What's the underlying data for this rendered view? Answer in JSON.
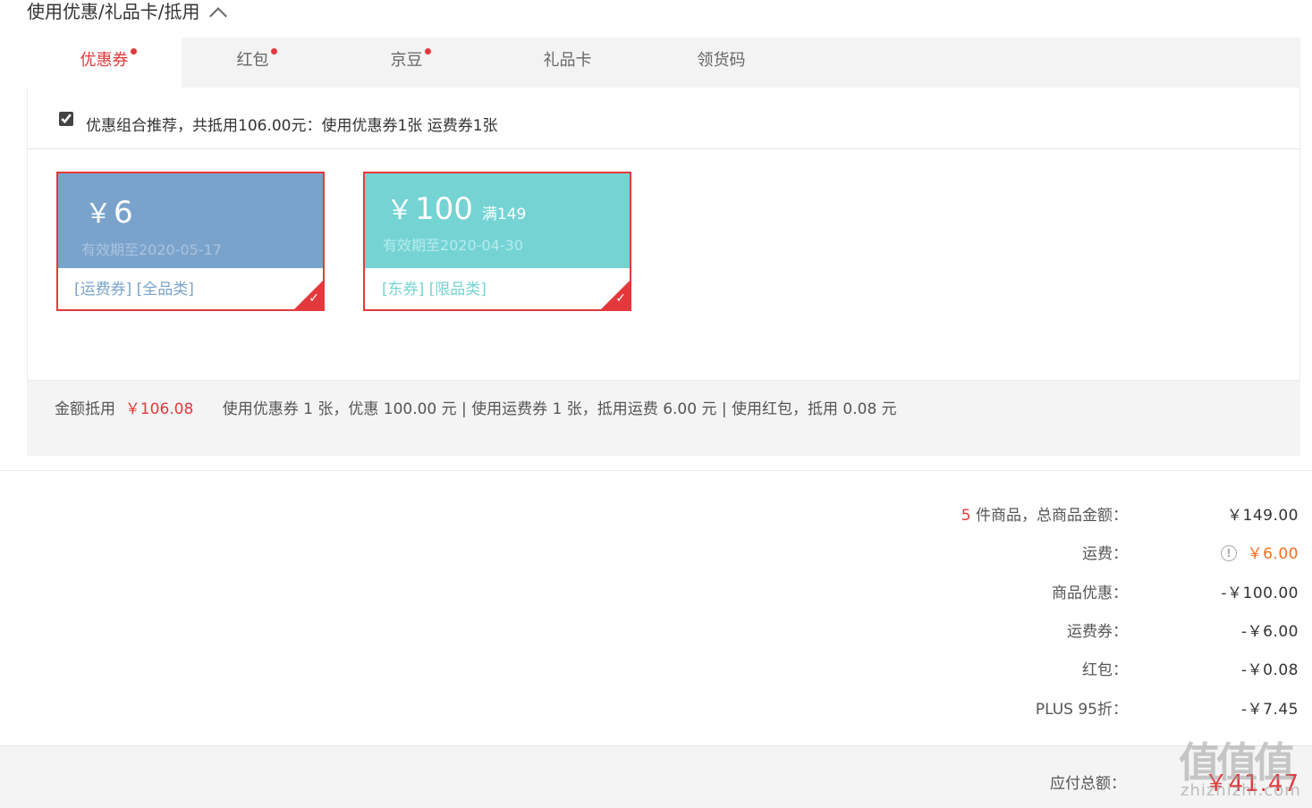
{
  "section": {
    "title": "使用优惠/礼品卡/抵用"
  },
  "tabs": [
    {
      "label": "优惠券",
      "dot": true,
      "active": true
    },
    {
      "label": "红包",
      "dot": true
    },
    {
      "label": "京豆",
      "dot": true
    },
    {
      "label": "礼品卡",
      "dot": false
    },
    {
      "label": "领货码",
      "dot": false
    }
  ],
  "recommend": {
    "checked": true,
    "text": "优惠组合推荐，共抵用106.00元：使用优惠券1张 运费券1张"
  },
  "coupons": [
    {
      "currency": "￥",
      "amount": "6",
      "condition": "",
      "expiry": "有效期至2020-05-17",
      "tags": "[运费券]  [全品类]",
      "selected": true,
      "color": "#7aa3cc"
    },
    {
      "currency": "￥",
      "amount": "100",
      "condition": "满149",
      "expiry": "有效期至2020-04-30",
      "tags": "[东券]  [限品类]",
      "selected": true,
      "color": "#75d3d4"
    }
  ],
  "summary": {
    "label": "金额抵用",
    "amount": "￥106.08",
    "detail": "使用优惠券 1 张，优惠 100.00 元  | 使用运费券 1 张，抵用运费 6.00 元  | 使用红包，抵用 0.08 元"
  },
  "prices": {
    "goods": {
      "count": "5",
      "label": " 件商品，总商品金额：",
      "value": "￥149.00"
    },
    "shipping": {
      "label": "运费：",
      "value": "￥6.00"
    },
    "discount": {
      "label": "商品优惠：",
      "value": "-￥100.00"
    },
    "shipping_coupon": {
      "label": "运费券：",
      "value": "-￥6.00"
    },
    "red_packet": {
      "label": "红包：",
      "value": "-￥0.08"
    },
    "plus": {
      "label": "PLUS 95折：",
      "value": "-￥7.45"
    }
  },
  "total": {
    "label": "应付总额：",
    "value": "￥41.47"
  },
  "watermark": {
    "logo": "值值值",
    "text": "zhizhizhi.com"
  },
  "colors": {
    "accent": "#e4393c",
    "orange": "#f56f1d",
    "coupon_blue": "#7aa3cc",
    "coupon_teal": "#75d3d4"
  }
}
